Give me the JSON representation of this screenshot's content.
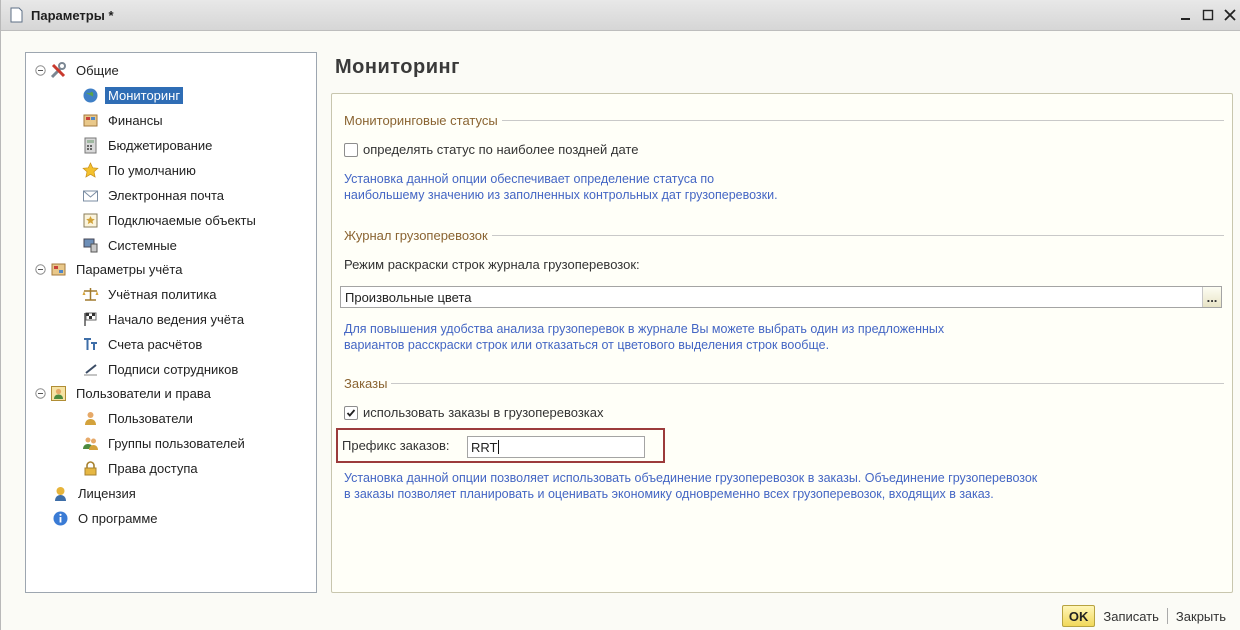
{
  "window": {
    "title": "Параметры *",
    "minimize": "_",
    "maximize": "□",
    "close": "×"
  },
  "nav": {
    "items": [
      {
        "label": "Общие",
        "icon": "tools-icon",
        "level": 0,
        "expanded": true
      },
      {
        "label": "Мониторинг",
        "icon": "globe-icon",
        "level": 1,
        "selected": true
      },
      {
        "label": "Финансы",
        "icon": "finance-icon",
        "level": 1
      },
      {
        "label": "Бюджетирование",
        "icon": "calculator-icon",
        "level": 1
      },
      {
        "label": "По умолчанию",
        "icon": "star-icon",
        "level": 1
      },
      {
        "label": "Электронная почта",
        "icon": "envelope-icon",
        "level": 1
      },
      {
        "label": "Подключаемые объекты",
        "icon": "plugin-icon",
        "level": 1
      },
      {
        "label": "Системные",
        "icon": "computer-icon",
        "level": 1
      },
      {
        "label": "Параметры учёта",
        "icon": "ledger-icon",
        "level": 0,
        "expanded": true
      },
      {
        "label": "Учётная политика",
        "icon": "scales-icon",
        "level": 1
      },
      {
        "label": "Начало ведения учёта",
        "icon": "flag-icon",
        "level": 1
      },
      {
        "label": "Счета расчётов",
        "icon": "accounts-icon",
        "level": 1
      },
      {
        "label": "Подписи сотрудников",
        "icon": "pen-icon",
        "level": 1
      },
      {
        "label": "Пользователи и права",
        "icon": "users-rights-icon",
        "level": 0,
        "expanded": true
      },
      {
        "label": "Пользователи",
        "icon": "user-icon",
        "level": 1
      },
      {
        "label": "Группы пользователей",
        "icon": "group-icon",
        "level": 1
      },
      {
        "label": "Права доступа",
        "icon": "lock-icon",
        "level": 1
      },
      {
        "label": "Лицензия",
        "icon": "license-icon",
        "level": 0
      },
      {
        "label": "О программе",
        "icon": "info-icon",
        "level": 0
      }
    ]
  },
  "main": {
    "title": "Мониторинг",
    "monitoring_statuses": {
      "header": "Мониторинговые статусы",
      "checkbox_label": "определять статус по наиболее поздней дате",
      "checked": false,
      "hint_line1": "Установка данной опции обеспечивает определение статуса по",
      "hint_line2": "наибольшему значению из заполненных контрольных дат грузоперевозки."
    },
    "journal": {
      "header": "Журнал грузоперевозок",
      "mode_label": "Режим раскраски строк журнала грузоперевозок:",
      "mode_value": "Произвольные цвета",
      "select_button": "...",
      "hint_line1": "Для повышения удобства анализа грузоперевок в журнале Вы можете выбрать один из предложенных",
      "hint_line2": "вариантов расскраски строк или отказаться от цветового выделения строк вообще."
    },
    "orders": {
      "header": "Заказы",
      "checkbox_label": "использовать заказы в грузоперевозках",
      "checked": true,
      "prefix_label": "Префикс заказов:",
      "prefix_value": "RRT",
      "hint_line1": "Установка данной опции позволяет использовать объединение грузоперевозок в заказы. Объединение грузоперевозок",
      "hint_line2": "в заказы позволяет планировать и оценивать экономику одновременно всех грузоперевозок, входящих в заказ."
    }
  },
  "footer": {
    "ok": "OK",
    "save": "Записать",
    "close": "Закрыть"
  },
  "colors": {
    "hint_blue": "#4466c4",
    "group_header_brown": "#8a6432",
    "selection_blue": "#2f6db5",
    "highlight_red": "#9c3b3b",
    "ok_yellow": "#f1d85a"
  }
}
